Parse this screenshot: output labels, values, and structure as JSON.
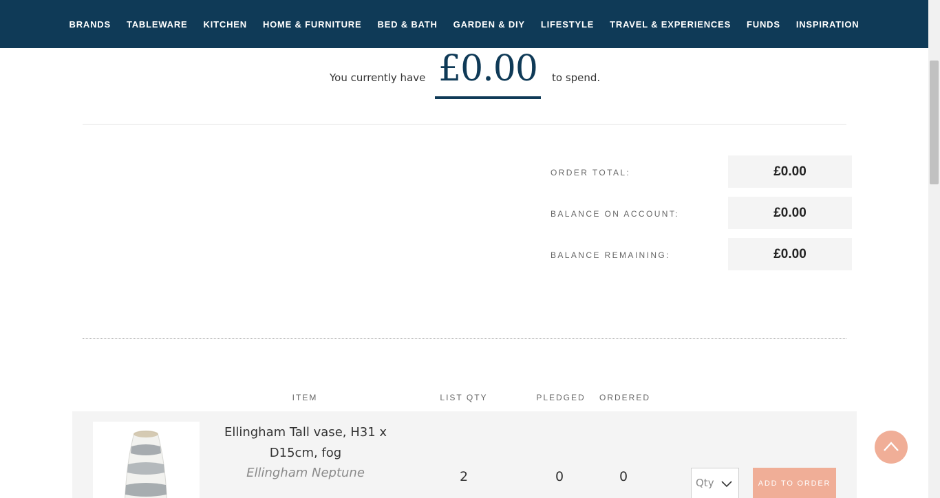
{
  "nav": {
    "items": [
      "BRANDS",
      "TABLEWARE",
      "KITCHEN",
      "HOME & FURNITURE",
      "BED & BATH",
      "GARDEN & DIY",
      "LIFESTYLE",
      "TRAVEL & EXPERIENCES",
      "FUNDS",
      "INSPIRATION"
    ]
  },
  "balance": {
    "prefix": "You currently have",
    "amount": "£0.00",
    "suffix": "to spend."
  },
  "totals": {
    "order_total_label": "ORDER TOTAL:",
    "order_total_value": "£0.00",
    "balance_on_account_label": "BALANCE ON ACCOUNT:",
    "balance_on_account_value": "£0.00",
    "balance_remaining_label": "BALANCE REMAINING:",
    "balance_remaining_value": "£0.00"
  },
  "table": {
    "headers": {
      "item": "ITEM",
      "list_qty": "LIST QTY",
      "pledged": "PLEDGED",
      "ordered": "ORDERED"
    },
    "rows": [
      {
        "title": "Ellingham Tall vase, H31 x D15cm, fog",
        "brand": "Ellingham Neptune",
        "list_qty": "2",
        "pledged": "0",
        "ordered": "0",
        "qty_placeholder": "Qty",
        "button_label": "ADD TO ORDER"
      }
    ]
  },
  "colors": {
    "nav_bg": "#0f3a57",
    "accent": "#f0ae97",
    "panel": "#f4f4f4"
  },
  "icons": {
    "qty_dropdown": "chevron-down-icon",
    "back_to_top": "chevron-up-icon"
  }
}
